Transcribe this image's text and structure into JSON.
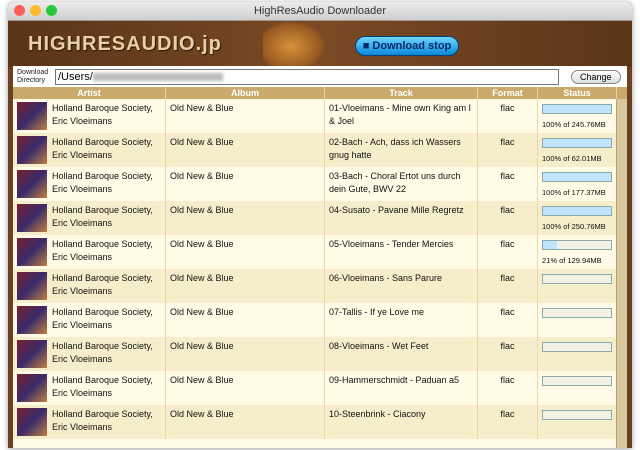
{
  "window": {
    "title": "HighResAudio Downloader"
  },
  "banner": {
    "logo": "HIGHRESAUDIO.jp",
    "download_button": "■ Download stop"
  },
  "directory": {
    "label": "Download Directory",
    "value": "/Users/",
    "change_label": "Change"
  },
  "table": {
    "columns": [
      "Artist",
      "Album",
      "Track",
      "Format",
      "Status"
    ],
    "rows": [
      {
        "artist": "Holland Baroque Society, Eric Vloeimans",
        "album": "Old New & Blue",
        "track": "01-Vloeimans - Mine own King am I & Joel",
        "format": "flac",
        "progress": 100,
        "status": "100% of 245.76MB"
      },
      {
        "artist": "Holland Baroque Society, Eric Vloeimans",
        "album": "Old New & Blue",
        "track": "02-Bach - Ach, dass ich Wassers gnug hatte",
        "format": "flac",
        "progress": 100,
        "status": "100% of 62.01MB"
      },
      {
        "artist": "Holland Baroque Society, Eric Vloeimans",
        "album": "Old New & Blue",
        "track": "03-Bach - Choral Ertot uns durch dein Gute, BWV 22",
        "format": "flac",
        "progress": 100,
        "status": "100% of 177.37MB"
      },
      {
        "artist": "Holland Baroque Society, Eric Vloeimans",
        "album": "Old New & Blue",
        "track": "04-Susato - Pavane Mille Regretz",
        "format": "flac",
        "progress": 100,
        "status": "100% of 250.76MB"
      },
      {
        "artist": "Holland Baroque Society, Eric Vloeimans",
        "album": "Old New & Blue",
        "track": "05-Vloeimans - Tender Mercies",
        "format": "flac",
        "progress": 21,
        "status": "21% of 129.94MB"
      },
      {
        "artist": "Holland Baroque Society, Eric Vloeimans",
        "album": "Old New & Blue",
        "track": "06-Vloeimans - Sans Parure",
        "format": "flac",
        "progress": 0,
        "status": ""
      },
      {
        "artist": "Holland Baroque Society, Eric Vloeimans",
        "album": "Old New & Blue",
        "track": "07-Tallis - If ye Love me",
        "format": "flac",
        "progress": 0,
        "status": ""
      },
      {
        "artist": "Holland Baroque Society, Eric Vloeimans",
        "album": "Old New & Blue",
        "track": "08-Vloeimans - Wet Feet",
        "format": "flac",
        "progress": 0,
        "status": ""
      },
      {
        "artist": "Holland Baroque Society, Eric Vloeimans",
        "album": "Old New & Blue",
        "track": "09-Hammerschmidt - Paduan a5",
        "format": "flac",
        "progress": 0,
        "status": ""
      },
      {
        "artist": "Holland Baroque Society, Eric Vloeimans",
        "album": "Old New & Blue",
        "track": "10-Steenbrink - Ciacony",
        "format": "flac",
        "progress": 0,
        "status": ""
      }
    ]
  }
}
